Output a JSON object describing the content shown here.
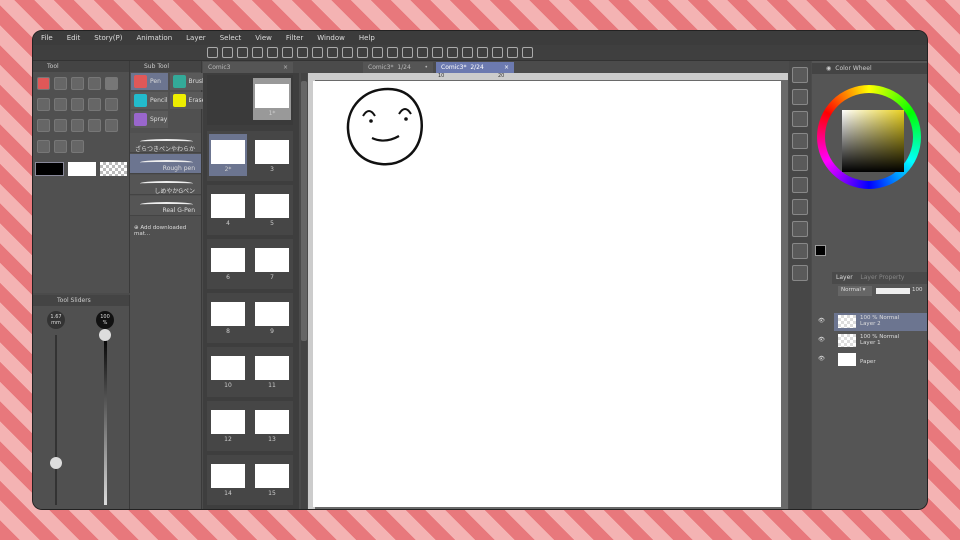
{
  "menu": [
    "File",
    "Edit",
    "Story(P)",
    "Animation",
    "Layer",
    "Select",
    "View",
    "Filter",
    "Window",
    "Help"
  ],
  "tool_panel": {
    "title": "Tool",
    "colors": {
      "main": "#000000",
      "sub": "#ffffff"
    }
  },
  "sub_tool": {
    "title": "Sub Tool",
    "groups": [
      "Pen",
      "Brush",
      "Pencil",
      "Eraser",
      "Spray"
    ],
    "brushes": [
      "ざらつきペンやわらか",
      "Rough pen",
      "しめやかGペン",
      "Real G-Pen"
    ],
    "selected": 1,
    "add": "Add downloaded mat..."
  },
  "tool_sliders": {
    "title": "Tool Sliders",
    "size": "1.67",
    "size_unit": "mm",
    "opacity": "100",
    "opacity_unit": "%",
    "size_level": 0.25,
    "opacity_level": 1.0
  },
  "tabs": [
    {
      "label": "Comic3",
      "close": "×"
    },
    {
      "label": "Comic3*",
      "page": "1/24",
      "close": "•"
    },
    {
      "label": "Comic3*",
      "page": "2/24",
      "close": "×"
    }
  ],
  "pages": [
    [
      "",
      "1*"
    ],
    [
      "2*",
      "3"
    ],
    [
      "4",
      "5"
    ],
    [
      "6",
      "7"
    ],
    [
      "8",
      "9"
    ],
    [
      "10",
      "11"
    ],
    [
      "12",
      "13"
    ],
    [
      "14",
      "15"
    ]
  ],
  "ruler": [
    "10",
    "20"
  ],
  "color_wheel": {
    "title": "Color Wheel",
    "hue": "#e8d020"
  },
  "layer_panel": {
    "tab1": "Layer",
    "tab2": "Layer Property",
    "blend": "Normal",
    "opacity": "100",
    "layers": [
      {
        "mode": "100 % Normal",
        "name": "Layer 2",
        "selected": true
      },
      {
        "mode": "100 % Normal",
        "name": "Layer 1"
      },
      {
        "mode": "",
        "name": "Paper"
      }
    ]
  }
}
